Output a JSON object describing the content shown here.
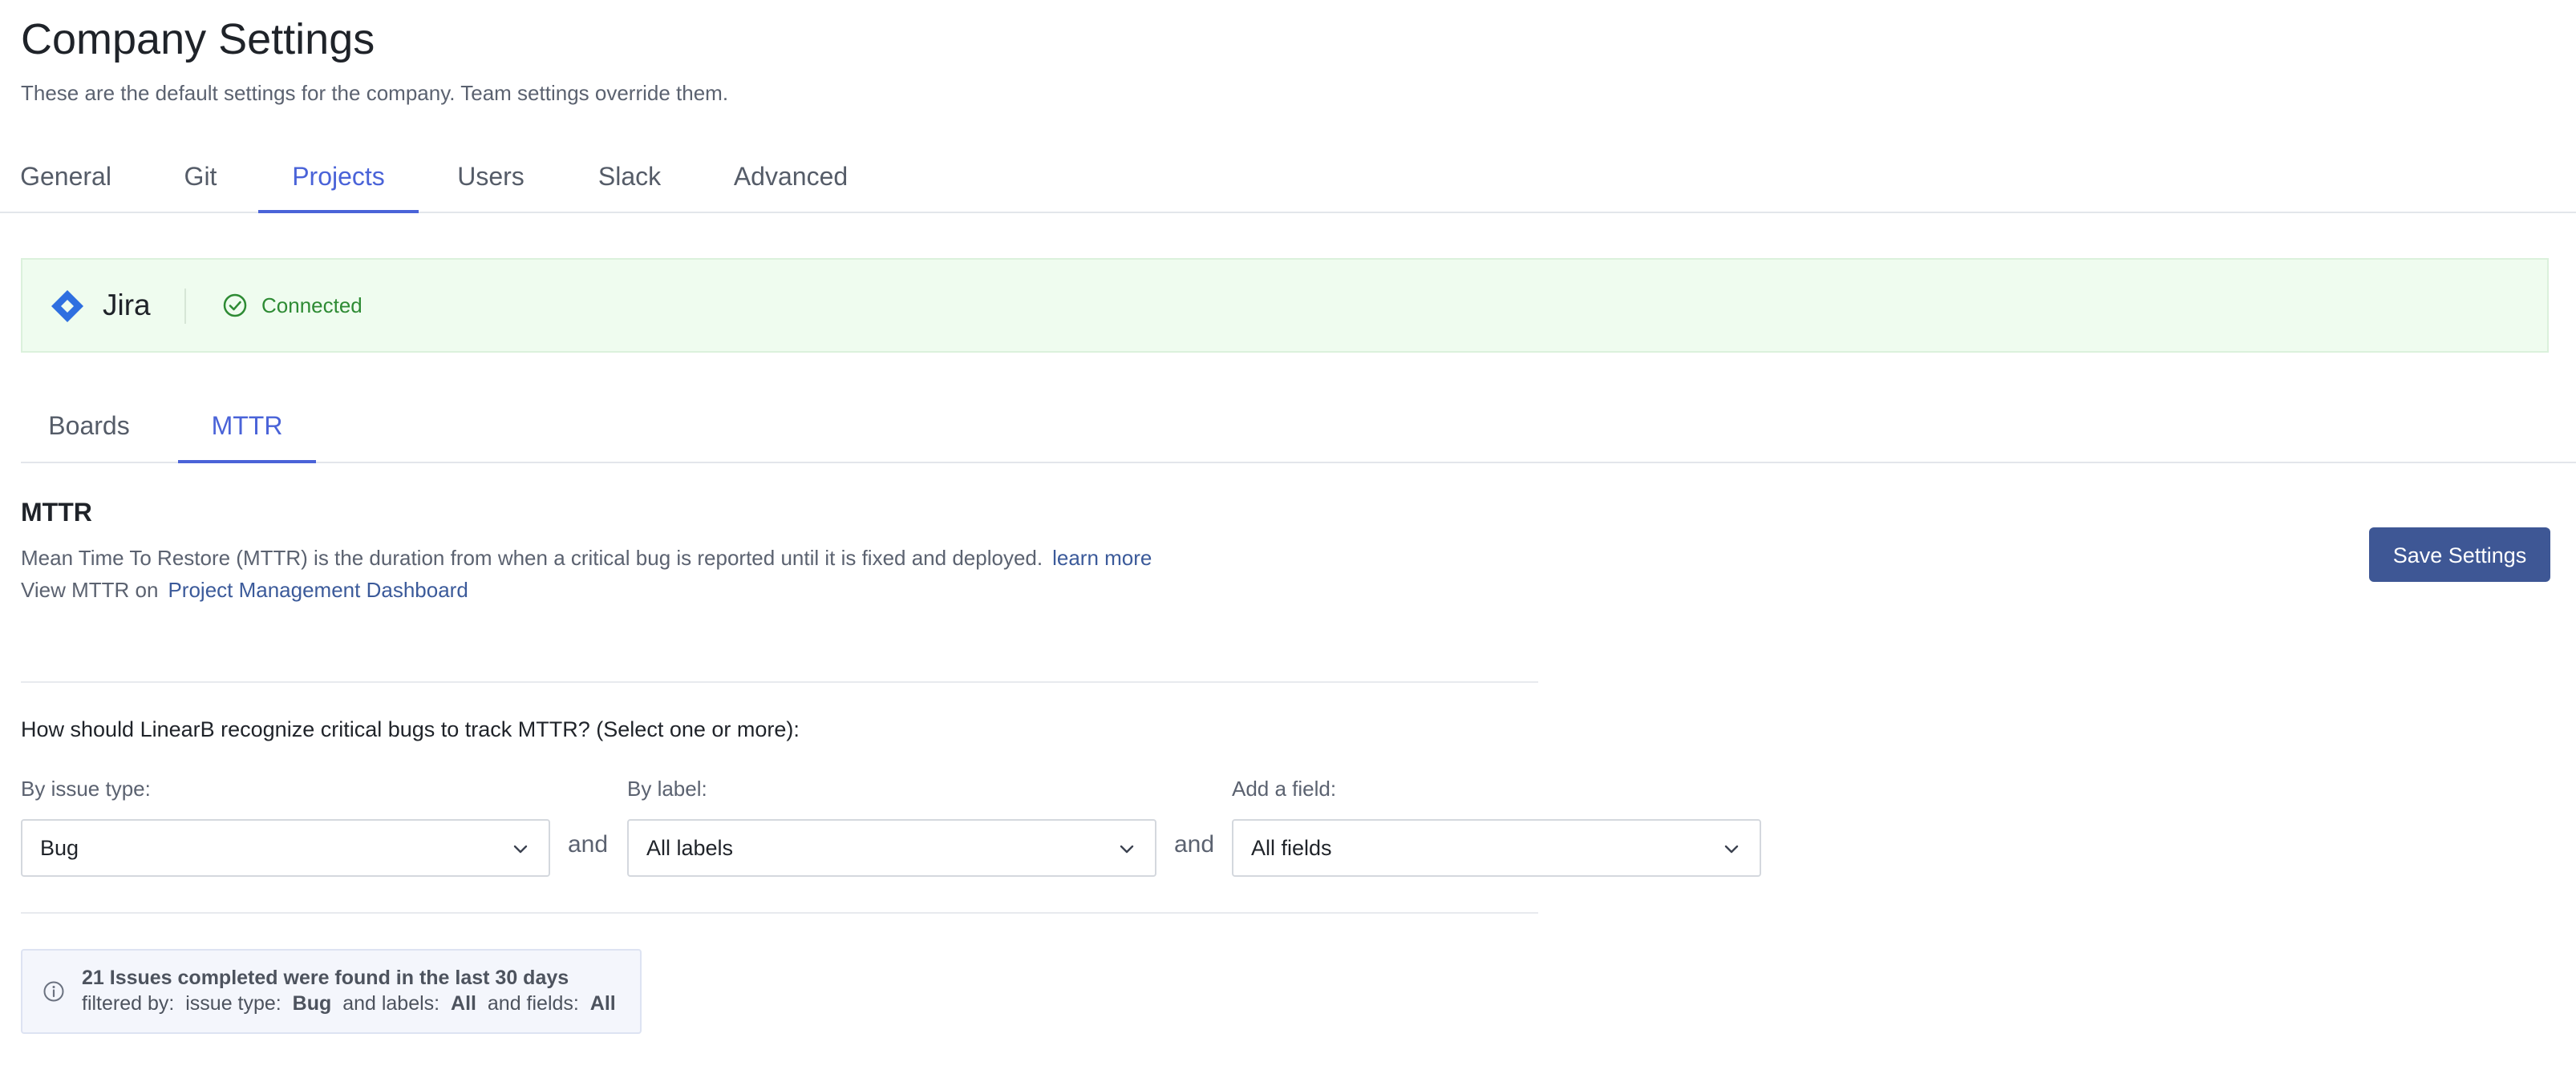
{
  "header": {
    "title": "Company Settings",
    "subtitle": "These are the default settings for the company. Team settings override them."
  },
  "main_tabs": [
    {
      "label": "General",
      "active": false
    },
    {
      "label": "Git",
      "active": false
    },
    {
      "label": "Projects",
      "active": true
    },
    {
      "label": "Users",
      "active": false
    },
    {
      "label": "Slack",
      "active": false
    },
    {
      "label": "Advanced",
      "active": false
    }
  ],
  "integration": {
    "icon": "jira-diamond-icon",
    "name": "Jira",
    "status_icon": "check-circle-icon",
    "status": "Connected",
    "banner_color": "#effcef",
    "status_color": "#2e8b34"
  },
  "sub_tabs": [
    {
      "label": "Boards",
      "active": false
    },
    {
      "label": "MTTR",
      "active": true
    }
  ],
  "mttr": {
    "heading": "MTTR",
    "description": "Mean Time To Restore (MTTR) is the duration from when a critical bug is reported until it is fixed and deployed.",
    "learn_more": "learn more",
    "view_prefix": "View MTTR on",
    "dashboard_link": "Project Management Dashboard",
    "save_button": "Save Settings",
    "question": "How should LinearB recognize critical bugs to track MTTR? (Select one or more):",
    "filters": [
      {
        "label": "By issue type:",
        "value": "Bug"
      },
      {
        "label": "By label:",
        "value": "All labels"
      },
      {
        "label": "Add a field:",
        "value": "All fields"
      }
    ],
    "connector": "and"
  },
  "summary": {
    "icon": "info-icon",
    "title": "21 Issues completed were found in the last 30 days",
    "filtered_by": "filtered by:",
    "issue_type_label": "issue type:",
    "issue_type_value": "Bug",
    "labels_label": "and labels:",
    "labels_value": "All",
    "fields_label": "and fields:",
    "fields_value": "All"
  },
  "colors": {
    "accent": "#4a63d8",
    "primary_button": "#3e5795",
    "link": "#3b5a9a"
  }
}
